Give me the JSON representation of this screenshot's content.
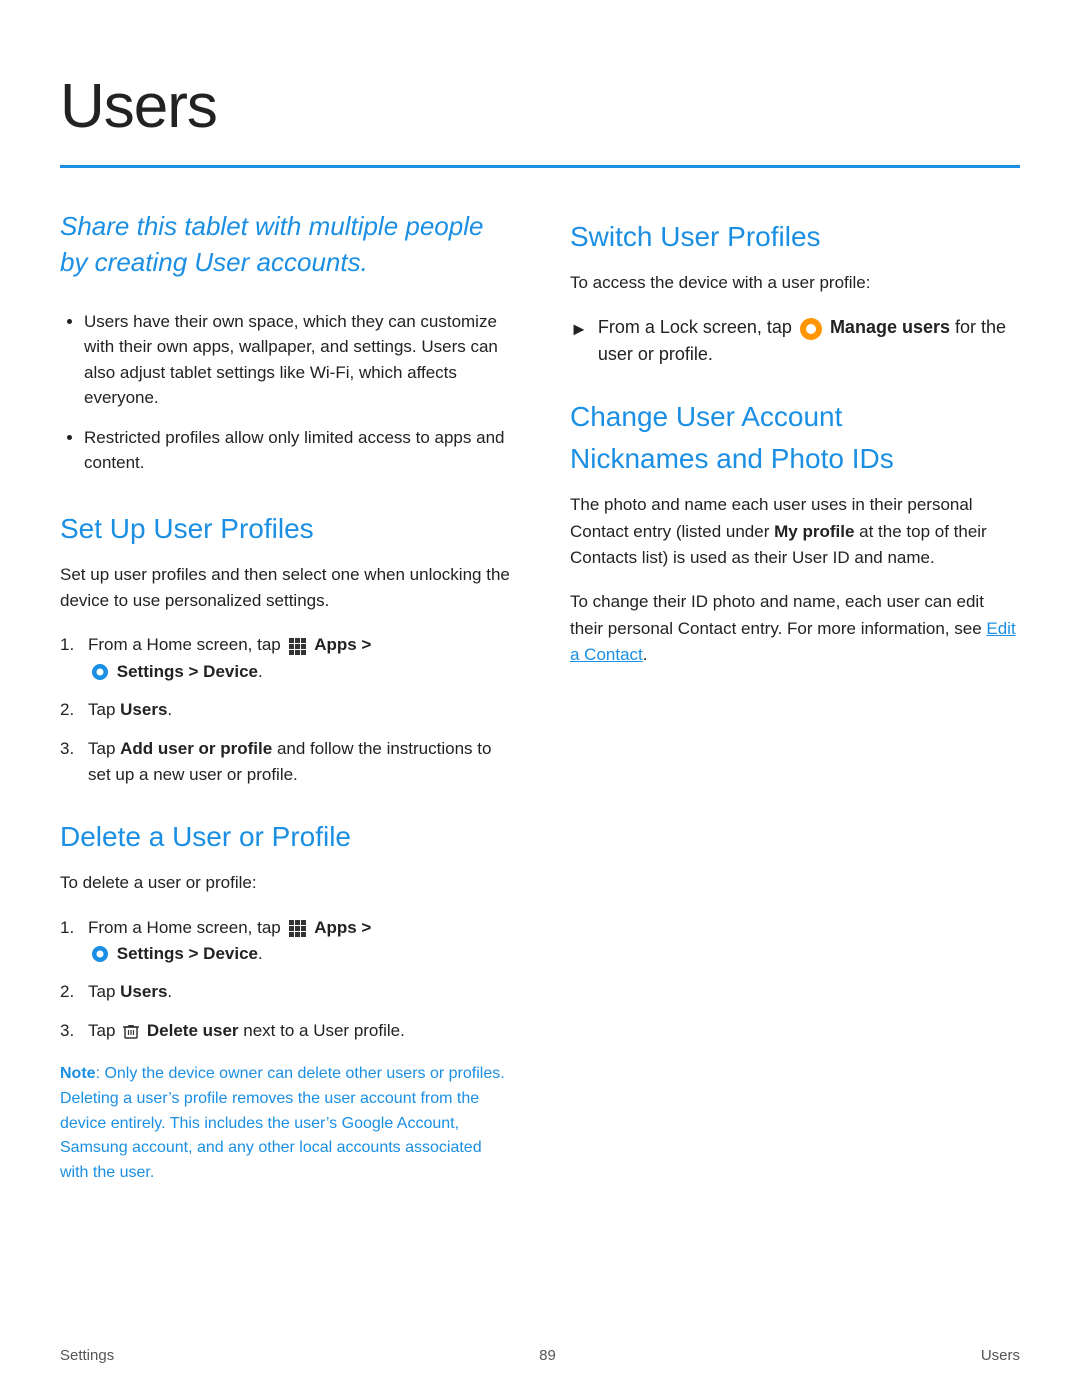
{
  "page": {
    "title": "Users",
    "footer_left": "Settings",
    "footer_center": "89",
    "footer_right": "Users"
  },
  "left_col": {
    "intro": "Share this tablet with multiple people by creating User accounts.",
    "bullets": [
      "Users have their own space, which they can customize with their own apps, wallpaper, and settings. Users can also adjust tablet settings like Wi-Fi, which affects everyone.",
      "Restricted profiles allow only limited access to apps and content."
    ],
    "set_up": {
      "heading": "Set Up User Profiles",
      "body": "Set up user profiles and then select one when unlocking the device to use personalized settings.",
      "steps": [
        {
          "num": "1.",
          "text_before": "From a Home screen, tap",
          "apps_label": "Apps >",
          "settings_label": "Settings > Device",
          "text_after": ""
        },
        {
          "num": "2.",
          "text_plain": "Tap",
          "bold_text": "Users",
          "text_after": "."
        },
        {
          "num": "3.",
          "text_before": "Tap",
          "bold_text": "Add user or profile",
          "text_after": "and follow the instructions to set up a new user or profile."
        }
      ]
    },
    "delete": {
      "heading": "Delete a User or Profile",
      "body": "To delete a user or profile:",
      "steps": [
        {
          "num": "1.",
          "text_before": "From a Home screen, tap",
          "apps_label": "Apps >",
          "settings_label": "Settings > Device",
          "text_after": ""
        },
        {
          "num": "2.",
          "text_plain": "Tap",
          "bold_text": "Users",
          "text_after": "."
        },
        {
          "num": "3.",
          "text_before": "Tap",
          "icon": "trash",
          "bold_text": "Delete user",
          "text_after": "next to a User profile."
        }
      ],
      "note_label": "Note",
      "note_text": ": Only the device owner can delete other users or profiles. Deleting a user’s profile removes the user account from the device entirely. This includes the user’s Google Account, Samsung account, and any other local accounts associated with the user."
    }
  },
  "right_col": {
    "switch": {
      "heading": "Switch User Profiles",
      "body": "To access the device with a user profile:",
      "bullet": {
        "text_before": "From a Lock screen, tap",
        "bold_text": "Manage users",
        "text_after": "for the user or profile."
      }
    },
    "change": {
      "heading_line1": "Change User Account",
      "heading_line2": "Nicknames and Photo IDs",
      "para1": "The photo and name each user uses in their personal Contact entry (listed under",
      "bold1": "My profile",
      "para1b": "at the top of their Contacts list) is used as their User ID and name.",
      "para2_before": "To change their ID photo and name, each user can edit their personal Contact entry. For more information, see",
      "link_text": "Edit a Contact",
      "para2_after": "."
    }
  }
}
